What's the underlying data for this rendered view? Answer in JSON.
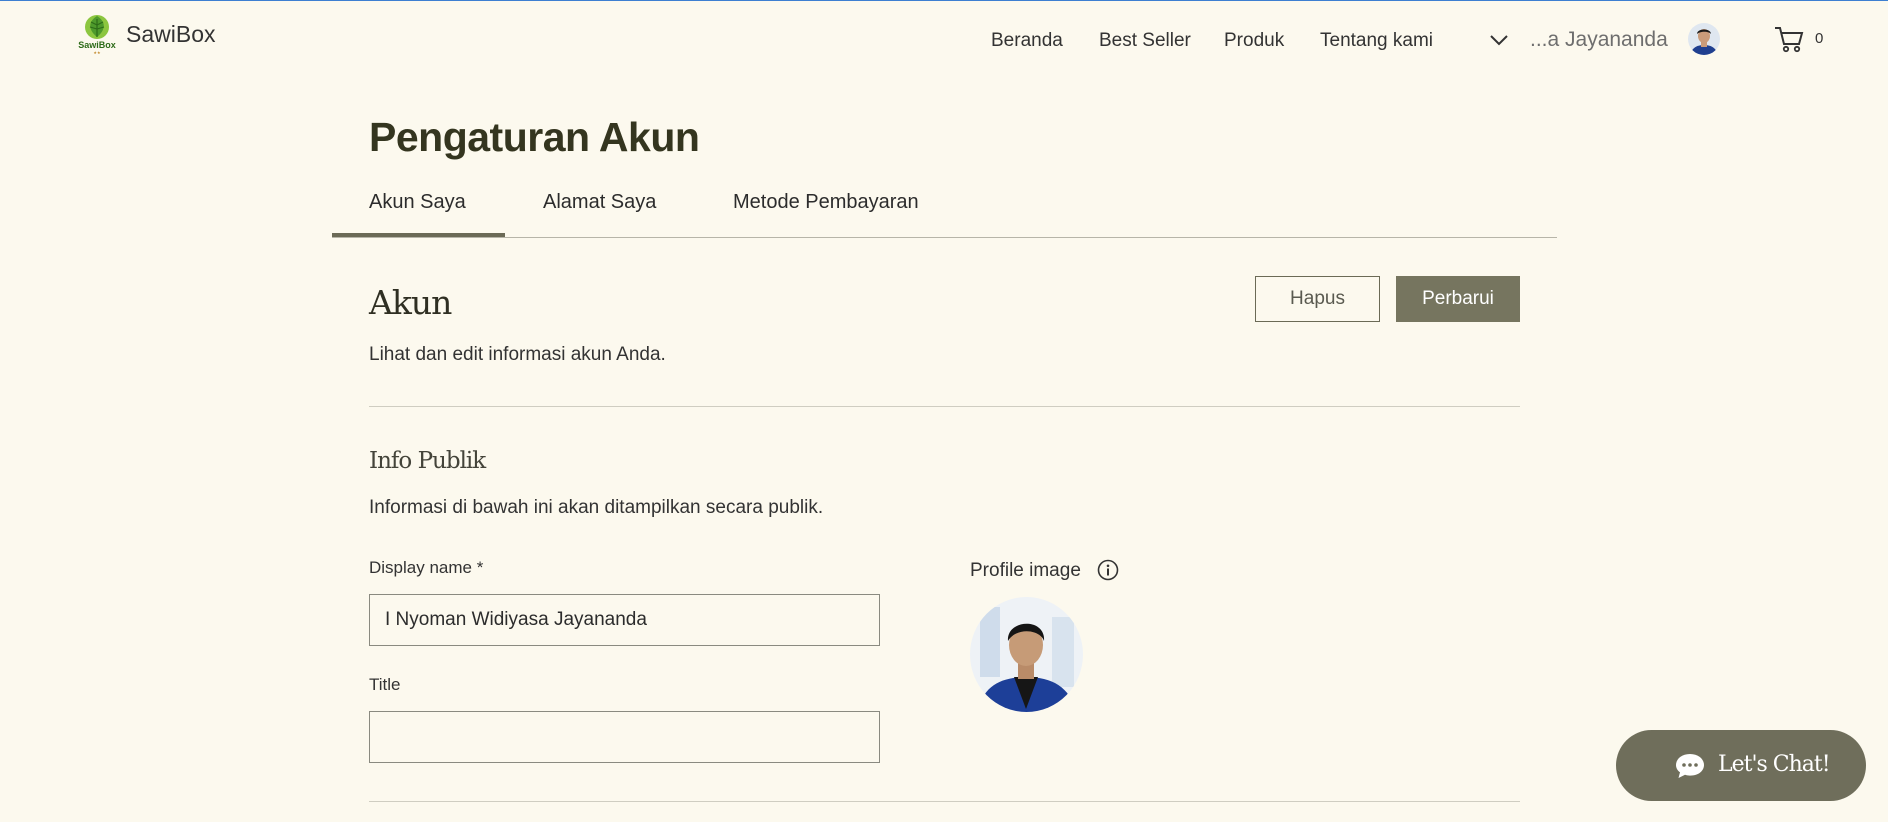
{
  "header": {
    "brand": "SawiBox",
    "logo_text": "SawiBox",
    "nav": [
      "Beranda",
      "Best Seller",
      "Produk",
      "Tentang kami"
    ],
    "user_name": "...a Jayananda",
    "cart_count": "0"
  },
  "page": {
    "title": "Pengaturan Akun",
    "tabs": [
      "Akun Saya",
      "Alamat Saya",
      "Metode Pembayaran"
    ],
    "active_tab": "Akun Saya"
  },
  "account": {
    "title": "Akun",
    "description": "Lihat dan edit informasi akun Anda.",
    "delete_label": "Hapus",
    "update_label": "Perbarui"
  },
  "public_info": {
    "title": "Info Publik",
    "description": "Informasi di bawah ini akan ditampilkan secara publik.",
    "display_name_label": "Display name *",
    "display_name_value": "I Nyoman Widiyasa Jayananda",
    "title_label": "Title",
    "title_value": "",
    "profile_image_label": "Profile image"
  },
  "chat": {
    "label": "Let's Chat!"
  },
  "colors": {
    "background": "#fcf9ee",
    "accent": "#76755f",
    "title": "#34351f"
  },
  "icons": [
    "sawibox-logo-icon",
    "chevron-down-icon",
    "cart-icon",
    "info-icon",
    "chat-bubble-icon"
  ]
}
